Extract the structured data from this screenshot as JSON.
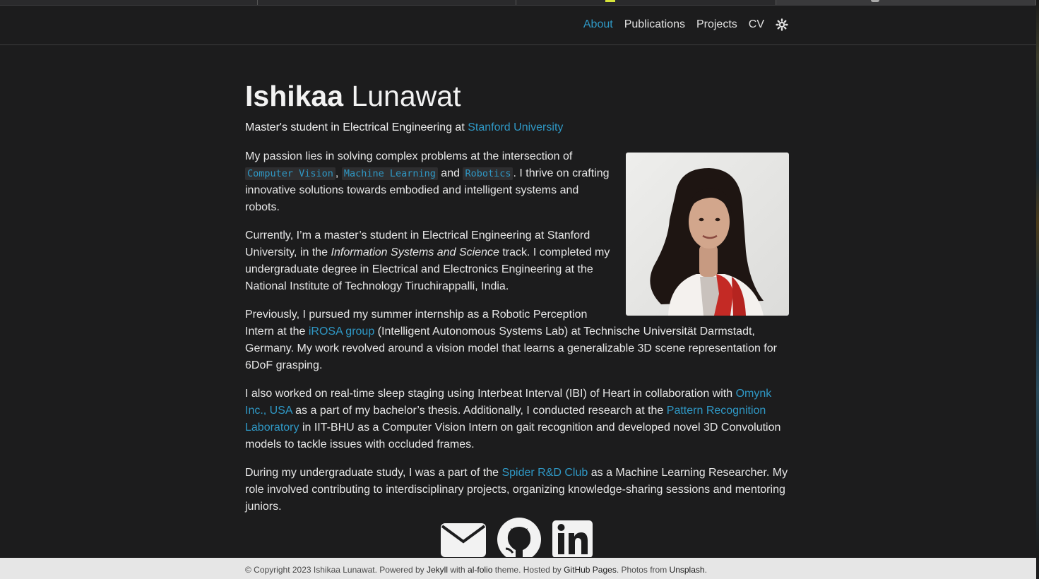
{
  "nav": {
    "items": [
      {
        "label": "About",
        "active": true
      },
      {
        "label": "Publications"
      },
      {
        "label": "Projects"
      },
      {
        "label": "CV"
      }
    ],
    "theme_icon": "sun-icon"
  },
  "header": {
    "first_name": "Ishikaa",
    "last_name": "Lunawat",
    "subtitle_prefix": "Master's student in Electrical Engineering at ",
    "subtitle_link": "Stanford University"
  },
  "profile": {
    "image": "profile-photo"
  },
  "paragraphs": {
    "p1": {
      "t1": "My passion lies in solving complex problems at the intersection of ",
      "code1": "Computer Vision",
      "t2": ", ",
      "code2": "Machine Learning",
      "t3": " and ",
      "code3": "Robotics",
      "t4": ". I thrive on crafting innovative solutions towards embodied and intelligent systems and robots."
    },
    "p2": {
      "t1": "Currently, I’m a master’s student in Electrical Engineering at Stanford University, in the ",
      "em": "Information Systems and Science",
      "t2": " track. I completed my undergraduate degree in Electrical and Electronics Engineering at the National Institute of Technology Tiruchirappalli, India."
    },
    "p3": {
      "t1": "Previously, I pursued my summer internship as a Robotic Perception Intern at the ",
      "link": "iROSA group",
      "t2": " (Intelligent Autonomous Systems Lab) at Technische Universität Darmstadt, Germany. My work revolved around a vision model that learns a generalizable 3D scene representation for 6DoF grasping."
    },
    "p4": {
      "t1": "I also worked on real-time sleep staging using Interbeat Interval (IBI) of Heart in collaboration with ",
      "link1": "Omynk Inc., USA",
      "t2": " as a part of my bachelor’s thesis. Additionally, I conducted research at the ",
      "link2": "Pattern Recognition Laboratory",
      "t3": " in IIT-BHU as a Computer Vision Intern on gait recognition and developed novel 3D Convolution models to tackle issues with occluded frames."
    },
    "p5": {
      "t1": "During my undergraduate study, I was a part of the ",
      "link": "Spider R&D Club",
      "t2": " as a Machine Learning Researcher. My role involved contributing to interdisciplinary projects, organizing knowledge-sharing sessions and mentoring juniors."
    }
  },
  "social": [
    "envelope-icon",
    "github-icon",
    "linkedin-icon"
  ],
  "footer": {
    "t1": "© Copyright 2023 Ishikaa Lunawat. Powered by ",
    "jekyll": "Jekyll",
    "t2": " with ",
    "alfolio": "al-folio",
    "t3": " theme. Hosted by ",
    "ghpages": "GitHub Pages",
    "t4": ". Photos from ",
    "unsplash": "Unsplash",
    "t5": "."
  },
  "colors": {
    "accent": "#2f98c5",
    "background": "#1c1c1d",
    "footer_bg": "#e6e6e6"
  }
}
